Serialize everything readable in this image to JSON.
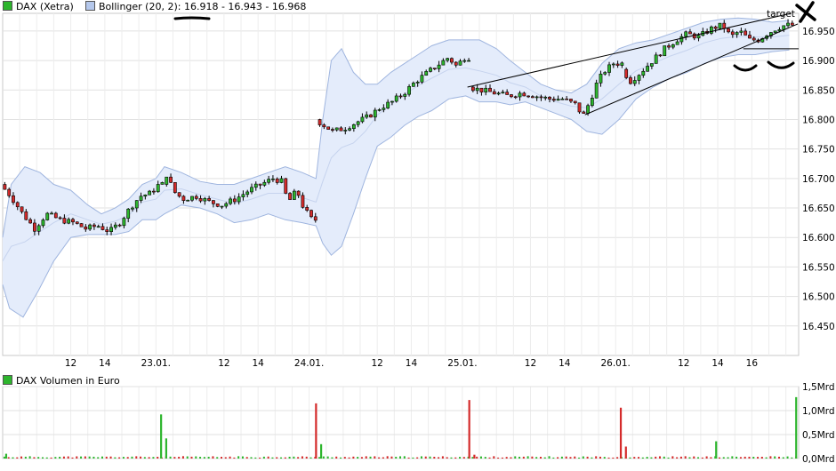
{
  "legend_price": {
    "label": "DAX (Xetra)",
    "color": "#2db52d"
  },
  "legend_bollinger": {
    "label": "Bollinger (20, 2): 16.918 - 16.943 - 16.968",
    "color": "#b5c8ec"
  },
  "legend_volume": {
    "label": "DAX Volumen in Euro",
    "color": "#2db52d"
  },
  "annotation_target": "target",
  "chart_data": [
    {
      "type": "candlestick",
      "title": "DAX (Xetra)",
      "ylim": [
        16400,
        16980
      ],
      "y_ticks": [
        "16.450",
        "16.500",
        "16.550",
        "16.600",
        "16.650",
        "16.700",
        "16.750",
        "16.800",
        "16.850",
        "16.900",
        "16.950"
      ],
      "y_tick_values": [
        16450,
        16500,
        16550,
        16600,
        16650,
        16700,
        16750,
        16800,
        16850,
        16900,
        16950
      ],
      "x_ticks": [
        "12",
        "14",
        "23.01.",
        "12",
        "14",
        "24.01.",
        "12",
        "14",
        "25.01.",
        "12",
        "14",
        "26.01.",
        "12",
        "14",
        "16"
      ],
      "x_tick_hours": [
        12,
        14,
        17,
        21,
        23,
        26,
        30,
        32,
        35,
        39,
        41,
        44,
        48,
        50,
        52
      ],
      "sessions": [
        {
          "start": 8,
          "end": 17.5,
          "points": [
            [
              8,
              16690
            ],
            [
              8.6,
              16670
            ],
            [
              9.3,
              16640
            ],
            [
              10,
              16615
            ],
            [
              10.7,
              16640
            ],
            [
              11.5,
              16630
            ],
            [
              12.3,
              16625
            ],
            [
              13,
              16615
            ],
            [
              13.7,
              16620
            ],
            [
              14.4,
              16610
            ],
            [
              15,
              16625
            ],
            [
              15.6,
              16650
            ],
            [
              16.2,
              16670
            ],
            [
              16.8,
              16675
            ],
            [
              17.3,
              16690
            ]
          ]
        },
        {
          "start": 17.5,
          "end": 26.5,
          "points": [
            [
              17.5,
              16690
            ],
            [
              17.8,
              16710
            ],
            [
              18.1,
              16680
            ],
            [
              18.7,
              16665
            ],
            [
              19.5,
              16670
            ],
            [
              20.3,
              16660
            ],
            [
              21,
              16655
            ],
            [
              21.8,
              16665
            ],
            [
              22.6,
              16680
            ],
            [
              23.3,
              16690
            ],
            [
              24,
              16700
            ],
            [
              24.5,
              16695
            ],
            [
              24.9,
              16660
            ],
            [
              25.4,
              16680
            ],
            [
              25.8,
              16650
            ],
            [
              26.3,
              16630
            ]
          ]
        },
        {
          "start": 26.5,
          "end": 35.5,
          "points": [
            [
              26.5,
              16800
            ],
            [
              27,
              16790
            ],
            [
              27.5,
              16780
            ],
            [
              28.2,
              16785
            ],
            [
              28.9,
              16795
            ],
            [
              29.6,
              16805
            ],
            [
              30.3,
              16820
            ],
            [
              31,
              16830
            ],
            [
              31.7,
              16845
            ],
            [
              32.4,
              16865
            ],
            [
              33.1,
              16880
            ],
            [
              33.8,
              16895
            ],
            [
              34.3,
              16905
            ],
            [
              34.8,
              16890
            ],
            [
              35.2,
              16905
            ]
          ]
        },
        {
          "start": 35.5,
          "end": 44.5,
          "points": [
            [
              35.5,
              16855
            ],
            [
              36.2,
              16850
            ],
            [
              37,
              16845
            ],
            [
              37.8,
              16840
            ],
            [
              38.6,
              16845
            ],
            [
              39.4,
              16840
            ],
            [
              40.2,
              16835
            ],
            [
              41,
              16835
            ],
            [
              41.8,
              16825
            ],
            [
              42.2,
              16805
            ],
            [
              42.6,
              16830
            ],
            [
              43,
              16860
            ],
            [
              43.4,
              16880
            ],
            [
              44,
              16895
            ]
          ]
        },
        {
          "start": 44.5,
          "end": 54.5,
          "points": [
            [
              44.5,
              16885
            ],
            [
              45,
              16865
            ],
            [
              45.6,
              16880
            ],
            [
              46.3,
              16900
            ],
            [
              47,
              16920
            ],
            [
              47.7,
              16935
            ],
            [
              48.3,
              16945
            ],
            [
              49,
              16940
            ],
            [
              49.8,
              16955
            ],
            [
              50.4,
              16960
            ],
            [
              50.9,
              16940
            ],
            [
              51.4,
              16950
            ],
            [
              52,
              16935
            ],
            [
              52.5,
              16935
            ],
            [
              53,
              16945
            ],
            [
              53.6,
              16955
            ],
            [
              54.1,
              16960
            ],
            [
              54.4,
              16960
            ]
          ]
        }
      ],
      "bollinger_upper": [
        [
          8,
          16600
        ],
        [
          8.5,
          16690
        ],
        [
          9.3,
          16720
        ],
        [
          10.2,
          16710
        ],
        [
          11,
          16690
        ],
        [
          12,
          16680
        ],
        [
          13,
          16655
        ],
        [
          13.8,
          16640
        ],
        [
          14.6,
          16650
        ],
        [
          15.4,
          16665
        ],
        [
          16.2,
          16690
        ],
        [
          17,
          16700
        ],
        [
          17.5,
          16720
        ],
        [
          18.5,
          16710
        ],
        [
          19.6,
          16695
        ],
        [
          20.6,
          16690
        ],
        [
          21.6,
          16690
        ],
        [
          22.6,
          16700
        ],
        [
          23.6,
          16710
        ],
        [
          24.6,
          16720
        ],
        [
          25.6,
          16710
        ],
        [
          26.4,
          16700
        ],
        [
          26.8,
          16800
        ],
        [
          27.3,
          16900
        ],
        [
          27.9,
          16920
        ],
        [
          28.6,
          16880
        ],
        [
          29.3,
          16860
        ],
        [
          30,
          16860
        ],
        [
          30.8,
          16880
        ],
        [
          31.6,
          16895
        ],
        [
          32.4,
          16910
        ],
        [
          33.2,
          16925
        ],
        [
          34.2,
          16935
        ],
        [
          35.2,
          16935
        ],
        [
          36,
          16935
        ],
        [
          37,
          16920
        ],
        [
          37.8,
          16900
        ],
        [
          38.7,
          16880
        ],
        [
          39.6,
          16860
        ],
        [
          40.5,
          16850
        ],
        [
          41.4,
          16845
        ],
        [
          42.3,
          16860
        ],
        [
          43.2,
          16895
        ],
        [
          44.2,
          16920
        ],
        [
          45.2,
          16930
        ],
        [
          46.2,
          16935
        ],
        [
          47.2,
          16945
        ],
        [
          48.2,
          16955
        ],
        [
          49.2,
          16965
        ],
        [
          50.2,
          16970
        ],
        [
          51.2,
          16972
        ],
        [
          52.2,
          16970
        ],
        [
          53.2,
          16965
        ],
        [
          54.2,
          16968
        ]
      ],
      "bollinger_lower": [
        [
          8,
          16520
        ],
        [
          8.4,
          16480
        ],
        [
          9.2,
          16465
        ],
        [
          10.1,
          16510
        ],
        [
          11,
          16560
        ],
        [
          12,
          16600
        ],
        [
          13,
          16605
        ],
        [
          13.8,
          16605
        ],
        [
          14.6,
          16605
        ],
        [
          15.4,
          16610
        ],
        [
          16.2,
          16630
        ],
        [
          17,
          16630
        ],
        [
          17.5,
          16640
        ],
        [
          18.5,
          16655
        ],
        [
          19.6,
          16650
        ],
        [
          20.6,
          16640
        ],
        [
          21.6,
          16625
        ],
        [
          22.6,
          16630
        ],
        [
          23.6,
          16640
        ],
        [
          24.6,
          16630
        ],
        [
          25.6,
          16625
        ],
        [
          26.4,
          16620
        ],
        [
          26.8,
          16590
        ],
        [
          27.3,
          16570
        ],
        [
          27.9,
          16585
        ],
        [
          28.6,
          16640
        ],
        [
          29.3,
          16700
        ],
        [
          30,
          16755
        ],
        [
          30.8,
          16770
        ],
        [
          31.6,
          16790
        ],
        [
          32.4,
          16805
        ],
        [
          33.2,
          16815
        ],
        [
          34.2,
          16835
        ],
        [
          35.2,
          16840
        ],
        [
          36,
          16830
        ],
        [
          37,
          16830
        ],
        [
          37.8,
          16825
        ],
        [
          38.7,
          16830
        ],
        [
          39.6,
          16820
        ],
        [
          40.5,
          16810
        ],
        [
          41.4,
          16800
        ],
        [
          42.3,
          16780
        ],
        [
          43.2,
          16775
        ],
        [
          44.2,
          16800
        ],
        [
          45.2,
          16835
        ],
        [
          46.2,
          16855
        ],
        [
          47.2,
          16870
        ],
        [
          48.2,
          16880
        ],
        [
          49.2,
          16895
        ],
        [
          50.2,
          16905
        ],
        [
          51.2,
          16910
        ],
        [
          52.2,
          16910
        ],
        [
          53.2,
          16915
        ],
        [
          54.2,
          16918
        ]
      ]
    },
    {
      "type": "bar",
      "title": "DAX Volumen in Euro",
      "ylim": [
        0,
        1.5
      ],
      "y_ticks": [
        "0,0Mrd",
        "0,5Mrd",
        "1,0Mrd",
        "1,5Mrd"
      ],
      "y_tick_values": [
        0,
        0.5,
        1.0,
        1.5
      ],
      "spikes": [
        [
          8.2,
          0.1,
          "green"
        ],
        [
          17.3,
          0.92,
          "green"
        ],
        [
          17.6,
          0.42,
          "green"
        ],
        [
          26.4,
          1.15,
          "red"
        ],
        [
          26.7,
          0.3,
          "green"
        ],
        [
          35.4,
          1.22,
          "red"
        ],
        [
          35.7,
          0.08,
          "red"
        ],
        [
          44.3,
          1.06,
          "red"
        ],
        [
          44.6,
          0.25,
          "red"
        ],
        [
          49.9,
          0.36,
          "green"
        ],
        [
          54.6,
          1.28,
          "green"
        ]
      ]
    }
  ]
}
